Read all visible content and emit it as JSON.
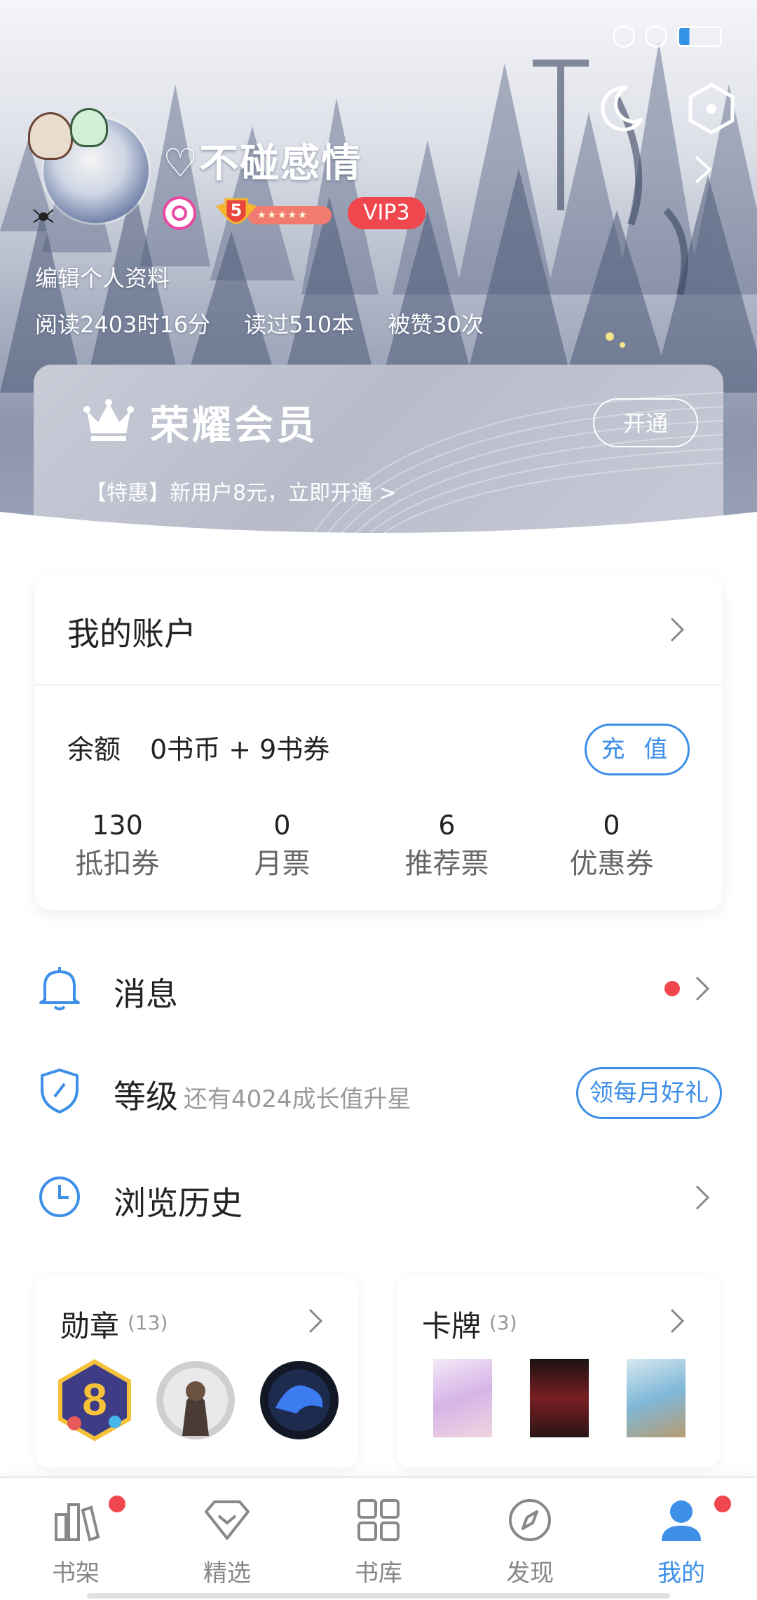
{
  "profile": {
    "username": "♡不碰感情",
    "level": "5",
    "vip": "VIP3",
    "edit_label": "编辑个人资料",
    "stats": [
      "阅读2403时16分",
      "读过510本",
      "被赞30次"
    ]
  },
  "vip_card": {
    "title": "荣耀会员",
    "button": "开通",
    "promo": "【特惠】新用户8元，立即开通 >"
  },
  "account": {
    "title": "我的账户",
    "balance_label": "余额",
    "balance_value": "0书币 + 9书券",
    "recharge": "充 值",
    "counts": [
      {
        "value": "130",
        "label": "抵扣券"
      },
      {
        "value": "0",
        "label": "月票"
      },
      {
        "value": "6",
        "label": "推荐票"
      },
      {
        "value": "0",
        "label": "优惠券"
      }
    ]
  },
  "menu": {
    "messages": "消息",
    "level": "等级",
    "level_sub": "还有4024成长值升星",
    "level_btn": "领每月好礼",
    "history": "浏览历史"
  },
  "medals": {
    "title": "勋章",
    "count": "(13)"
  },
  "cards": {
    "title": "卡牌",
    "count": "(3)"
  },
  "tabs": [
    {
      "label": "书架",
      "icon": "bookshelf-icon"
    },
    {
      "label": "精选",
      "icon": "diamond-icon"
    },
    {
      "label": "书库",
      "icon": "grid-icon"
    },
    {
      "label": "发现",
      "icon": "compass-icon"
    },
    {
      "label": "我的",
      "icon": "person-icon"
    }
  ],
  "colors": {
    "accent": "#3d8fe8",
    "red": "#f0474e"
  }
}
